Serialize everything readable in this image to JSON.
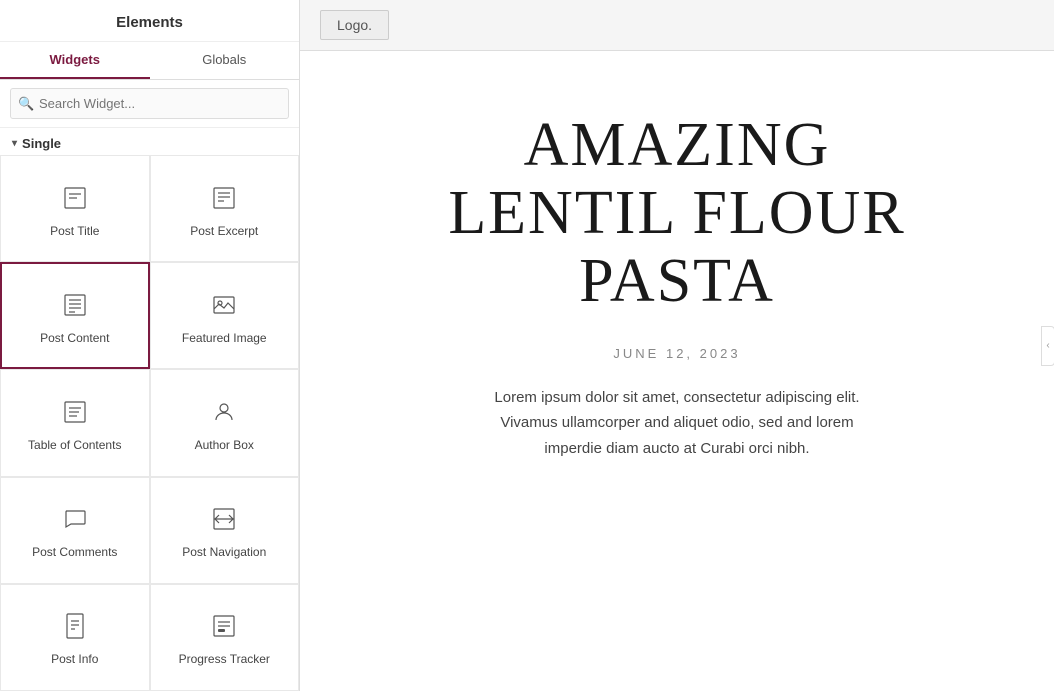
{
  "panel": {
    "header": "Elements",
    "tabs": [
      {
        "id": "widgets",
        "label": "Widgets",
        "active": true
      },
      {
        "id": "globals",
        "label": "Globals",
        "active": false
      }
    ],
    "search": {
      "placeholder": "Search Widget..."
    },
    "section": {
      "label": "Single",
      "arrow": "▾"
    },
    "widgets": [
      {
        "id": "post-title",
        "label": "Post Title",
        "icon": "post-title",
        "selected": false
      },
      {
        "id": "post-excerpt",
        "label": "Post Excerpt",
        "icon": "post-excerpt",
        "selected": false
      },
      {
        "id": "post-content",
        "label": "Post Content",
        "icon": "post-content",
        "selected": true
      },
      {
        "id": "featured-image",
        "label": "Featured Image",
        "icon": "featured-image",
        "selected": false
      },
      {
        "id": "table-of-contents",
        "label": "Table of Contents",
        "icon": "table-of-contents",
        "selected": false
      },
      {
        "id": "author-box",
        "label": "Author Box",
        "icon": "author-box",
        "selected": false
      },
      {
        "id": "post-comments",
        "label": "Post Comments",
        "icon": "post-comments",
        "selected": false
      },
      {
        "id": "post-navigation",
        "label": "Post Navigation",
        "icon": "post-navigation",
        "selected": false
      },
      {
        "id": "post-info",
        "label": "Post Info",
        "icon": "post-info",
        "selected": false
      },
      {
        "id": "progress-tracker",
        "label": "Progress Tracker",
        "icon": "progress-tracker",
        "selected": false
      }
    ]
  },
  "preview": {
    "logo_text": "Logo.",
    "post_title": "AMAZING LENTIL FLOUR PASTA",
    "post_date": "JUNE 12, 2023",
    "post_excerpt": "Lorem ipsum dolor sit amet, consectetur adipiscing elit. Vivamus ullamcorper and aliquet odio, sed and lorem imperdie diam aucto at Curabi orci nibh."
  }
}
